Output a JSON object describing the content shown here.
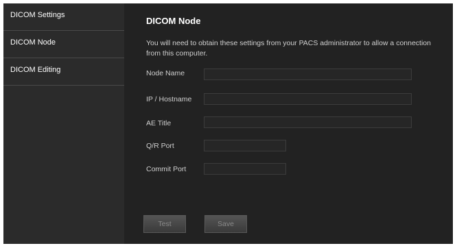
{
  "sidebar": {
    "items": [
      {
        "label": "DICOM Settings"
      },
      {
        "label": "DICOM Node"
      },
      {
        "label": "DICOM Editing"
      }
    ]
  },
  "main": {
    "title": "DICOM Node",
    "description": "You will need to obtain these settings from your PACS administrator to allow a connection from this computer.",
    "fields": {
      "node_name": {
        "label": "Node Name",
        "value": ""
      },
      "ip_hostname": {
        "label": "IP / Hostname",
        "value": ""
      },
      "ae_title": {
        "label": "AE Title",
        "value": ""
      },
      "qr_port": {
        "label": "Q/R Port",
        "value": ""
      },
      "commit_port": {
        "label": "Commit Port",
        "value": ""
      }
    },
    "buttons": {
      "test": "Test",
      "save": "Save"
    }
  }
}
